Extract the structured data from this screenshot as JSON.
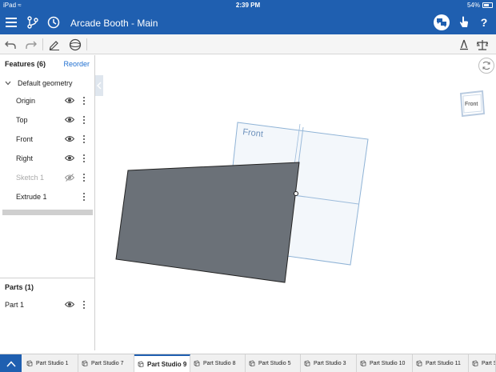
{
  "status_bar": {
    "device": "iPad",
    "time": "2:39 PM",
    "battery": "54%",
    "battery_level": 0.54
  },
  "header": {
    "document_name": "Arcade Booth",
    "separator": " - ",
    "workspace": "Main",
    "help_label": "?"
  },
  "features": {
    "title": "Features (6)",
    "reorder_label": "Reorder",
    "group_label": "Default geometry",
    "items": [
      {
        "label": "Origin",
        "visible": true
      },
      {
        "label": "Top",
        "visible": true
      },
      {
        "label": "Front",
        "visible": true
      },
      {
        "label": "Right",
        "visible": true
      },
      {
        "label": "Sketch 1",
        "visible": false
      },
      {
        "label": "Extrude 1",
        "visible": null
      }
    ]
  },
  "parts": {
    "title": "Parts (1)",
    "items": [
      {
        "label": "Part 1",
        "visible": true
      }
    ]
  },
  "viewport": {
    "plane_label": "Front",
    "view_cube_label": "Front",
    "part_color": "#6b7178",
    "plane_color": "#8fb3d6"
  },
  "tabs": {
    "items": [
      {
        "label": "Part Studio 1",
        "active": false
      },
      {
        "label": "Part Studio 7",
        "active": false
      },
      {
        "label": "Part Studio 9",
        "active": true
      },
      {
        "label": "Part Studio 8",
        "active": false
      },
      {
        "label": "Part Studio 5",
        "active": false
      },
      {
        "label": "Part Studio 3",
        "active": false
      },
      {
        "label": "Part Studio 10",
        "active": false
      },
      {
        "label": "Part Studio 11",
        "active": false
      },
      {
        "label": "Part Stu",
        "active": false
      }
    ]
  },
  "colors": {
    "brand_blue": "#1f5fb0",
    "link_blue": "#1f6fd0"
  }
}
